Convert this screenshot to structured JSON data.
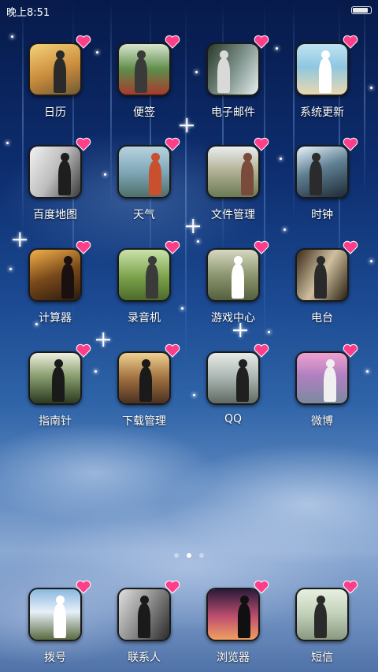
{
  "status_bar": {
    "time": "晚上8:51",
    "battery_level": 0.9
  },
  "apps": [
    {
      "label": "日历",
      "icon": "calendar-photo-icon"
    },
    {
      "label": "便签",
      "icon": "notes-photo-icon"
    },
    {
      "label": "电子邮件",
      "icon": "email-photo-icon"
    },
    {
      "label": "系统更新",
      "icon": "update-photo-icon"
    },
    {
      "label": "百度地图",
      "icon": "map-photo-icon"
    },
    {
      "label": "天气",
      "icon": "weather-photo-icon"
    },
    {
      "label": "文件管理",
      "icon": "files-photo-icon"
    },
    {
      "label": "时钟",
      "icon": "clock-photo-icon"
    },
    {
      "label": "计算器",
      "icon": "calculator-photo-icon"
    },
    {
      "label": "录音机",
      "icon": "recorder-photo-icon"
    },
    {
      "label": "游戏中心",
      "icon": "game-center-photo-icon"
    },
    {
      "label": "电台",
      "icon": "radio-photo-icon"
    },
    {
      "label": "指南针",
      "icon": "compass-photo-icon"
    },
    {
      "label": "下载管理",
      "icon": "downloads-photo-icon"
    },
    {
      "label": "QQ",
      "icon": "qq-photo-icon"
    },
    {
      "label": "微博",
      "icon": "weibo-photo-icon"
    }
  ],
  "dock": [
    {
      "label": "拨号",
      "icon": "dialer-photo-icon"
    },
    {
      "label": "联系人",
      "icon": "contacts-photo-icon"
    },
    {
      "label": "浏览器",
      "icon": "browser-photo-icon"
    },
    {
      "label": "短信",
      "icon": "messages-photo-icon"
    }
  ],
  "page_indicator": {
    "pages": 3,
    "current": 2
  },
  "colors": {
    "heart": "#ff3e8a",
    "label": "#ffffff",
    "wallpaper_top": "#071a4a"
  }
}
